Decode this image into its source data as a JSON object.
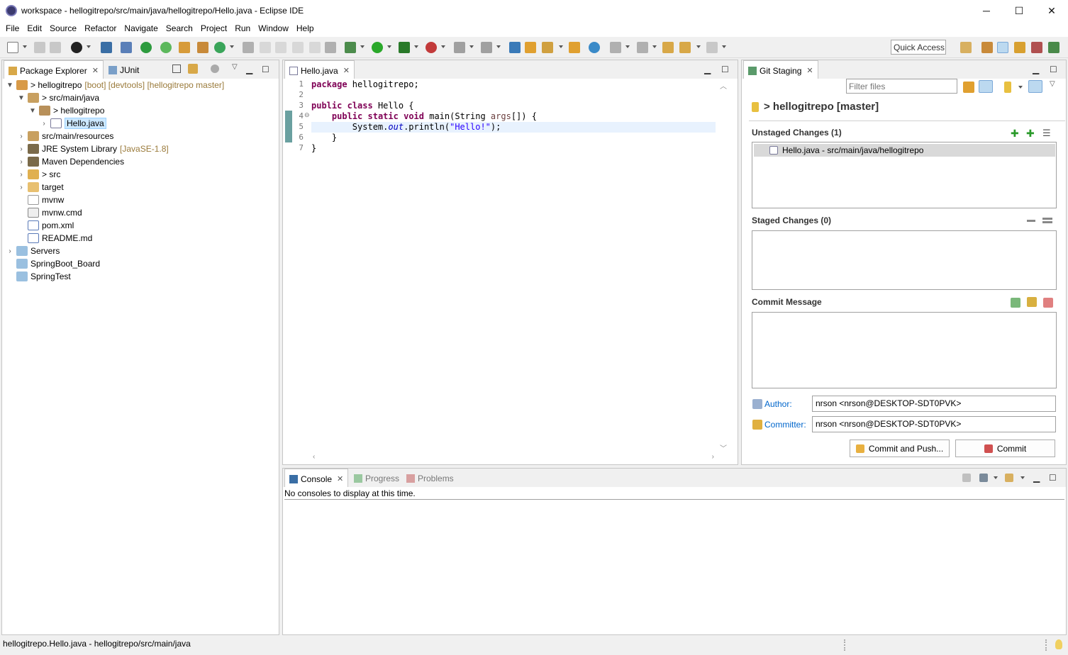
{
  "window": {
    "title": "workspace - hellogitrepo/src/main/java/hellogitrepo/Hello.java - Eclipse IDE",
    "minimize": "─",
    "maximize": "☐",
    "close": "✕"
  },
  "menu": [
    "File",
    "Edit",
    "Source",
    "Refactor",
    "Navigate",
    "Search",
    "Project",
    "Run",
    "Window",
    "Help"
  ],
  "toolbar": {
    "quick_access": "Quick Access"
  },
  "package_explorer": {
    "tab_label": "Package Explorer",
    "junit_tab_label": "JUnit",
    "tree": {
      "repo": "> hellogitrepo",
      "repo_decor": "[boot] [devtools] [hellogitrepo master]",
      "src_main_java": "> src/main/java",
      "pkg": "> hellogitrepo",
      "hello_java": "Hello.java",
      "src_main_resources": "src/main/resources",
      "jre": "JRE System Library",
      "jre_decor": "[JavaSE-1.8]",
      "maven": "Maven Dependencies",
      "src": "> src",
      "target": "target",
      "mvnw": "mvnw",
      "mvnw_cmd": "mvnw.cmd",
      "pom": "pom.xml",
      "readme": "README.md",
      "servers": "Servers",
      "springboot_board": "SpringBoot_Board",
      "springtest": "SpringTest"
    }
  },
  "editor": {
    "tab_label": "Hello.java",
    "line_numbers": [
      "1",
      "2",
      "3",
      "4",
      "5",
      "6",
      "7"
    ],
    "code": {
      "l1_kw": "package",
      "l1_rest": " hellogitrepo;",
      "l3_kw1": "public",
      "l3_kw2": "class",
      "l3_rest": " Hello {",
      "l4_indent": "    ",
      "l4_kw1": "public",
      "l4_kw2": "static",
      "l4_kw3": "void",
      "l4_mid": " main(String ",
      "l4_param": "args",
      "l4_end": "[]) {",
      "l5_indent": "        System.",
      "l5_field": "out",
      "l5_mid": ".println(",
      "l5_str": "\"Hello!\"",
      "l5_end": ");",
      "l6": "    }",
      "l7": "}"
    }
  },
  "git_staging": {
    "tab_label": "Git Staging",
    "filter_placeholder": "Filter files",
    "repo_header": "> hellogitrepo [master]",
    "unstaged_title": "Unstaged Changes (1)",
    "unstaged_items": [
      "Hello.java - src/main/java/hellogitrepo"
    ],
    "staged_title": "Staged Changes (0)",
    "commit_message_title": "Commit Message",
    "author_label": "Author:",
    "author_value": "nrson <nrson@DESKTOP-SDT0PVK>",
    "committer_label": "Committer:",
    "committer_value": "nrson <nrson@DESKTOP-SDT0PVK>",
    "commit_and_push_label": "Commit and Push...",
    "commit_label": "Commit"
  },
  "console": {
    "tab_label": "Console",
    "progress_tab_label": "Progress",
    "problems_tab_label": "Problems",
    "message": "No consoles to display at this time."
  },
  "status_bar": {
    "text": "hellogitrepo.Hello.java - hellogitrepo/src/main/java"
  }
}
